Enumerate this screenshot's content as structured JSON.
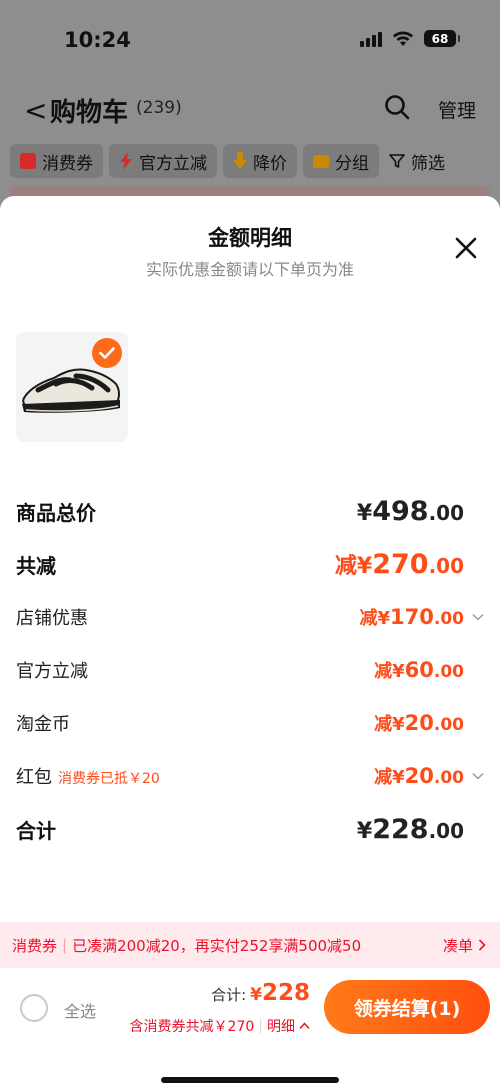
{
  "status": {
    "time": "10:24",
    "battery": "68"
  },
  "nav": {
    "back_glyph": "<",
    "title": "购物车",
    "count": "(239)",
    "manage": "管理"
  },
  "filters": [
    {
      "label": "消费券",
      "icon": "coupon-icon",
      "color": "#ff3a3a"
    },
    {
      "label": "官方立减",
      "icon": "lightning-icon",
      "color": "#ff3a3a"
    },
    {
      "label": "降价",
      "icon": "arrow-down-icon",
      "color": "#ffb000"
    },
    {
      "label": "分组",
      "icon": "folder-icon",
      "color": "#ffb000"
    },
    {
      "label": "筛选",
      "icon": "filter-icon",
      "color": "#111111"
    }
  ],
  "sheet": {
    "title": "金额明细",
    "subtitle": "实际优惠金额请以下单页为准"
  },
  "breakdown": {
    "goods_total": {
      "label": "商品总价",
      "prefix": "¥",
      "int": "498",
      "dec": ".00"
    },
    "total_reduction": {
      "label": "共减",
      "prefix": "减¥",
      "int": "270",
      "dec": ".00"
    },
    "shop_discount": {
      "label": "店铺优惠",
      "prefix": "减¥",
      "int": "170",
      "dec": ".00"
    },
    "official_discount": {
      "label": "官方立减",
      "prefix": "减¥",
      "int": "60",
      "dec": ".00"
    },
    "taojinbi": {
      "label": "淘金币",
      "prefix": "减¥",
      "int": "20",
      "dec": ".00"
    },
    "red_packet": {
      "label": "红包",
      "note": "消费券已抵￥20",
      "prefix": "减¥",
      "int": "20",
      "dec": ".00"
    },
    "sum": {
      "label": "合计",
      "prefix": "¥",
      "int": "228",
      "dec": ".00"
    }
  },
  "promo": {
    "tag": "消费券",
    "text": "已凑满200减20，再实付252享满500减50",
    "action": "凑单"
  },
  "bottom": {
    "select_all": "全选",
    "total_label": "合计:",
    "total_currency": "¥",
    "total_value": "228",
    "sub_text": "含消费券共减￥270",
    "detail": "明细",
    "pay_button": "领券结算(1)"
  },
  "colors": {
    "accent": "#ff4d1a",
    "promo_red": "#e8132b",
    "pay_from": "#ff7a1a",
    "pay_to": "#ff4f0e"
  }
}
